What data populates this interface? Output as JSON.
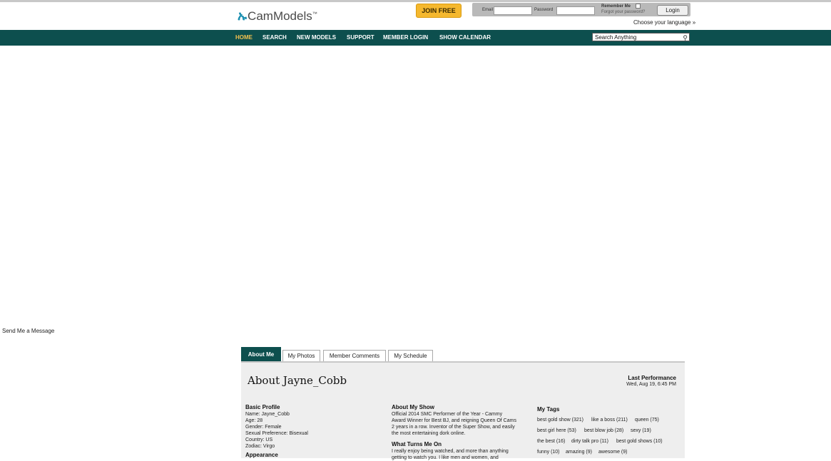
{
  "header": {
    "logo_text": "CamModels",
    "logo_tm": "™",
    "join_label": "JOIN FREE",
    "login": {
      "email_label": "Email",
      "password_label": "Password",
      "remember_label": "Remember Me",
      "forgot_label": "Forgot your password?",
      "login_button": "Login"
    },
    "choose_language": "Choose your language »"
  },
  "nav": {
    "items": [
      {
        "label": "HOME",
        "active": true
      },
      {
        "label": "SEARCH"
      },
      {
        "label": "NEW MODELS"
      },
      {
        "label": "SUPPORT"
      },
      {
        "label": "MEMBER LOGIN"
      },
      {
        "label": "SHOW CALENDAR"
      }
    ],
    "search_value": "Search Anything"
  },
  "send_message": "Send Me a Message",
  "tabs": [
    {
      "label": "About Me",
      "active": true
    },
    {
      "label": "My Photos"
    },
    {
      "label": "Member Comments"
    },
    {
      "label": "My Schedule"
    }
  ],
  "profile": {
    "title": "About Jayne_Cobb",
    "last_performance_label": "Last Performance",
    "last_performance_date": "Wed, Aug 19, 6:45 PM",
    "basic_heading": "Basic Profile",
    "basic_lines": [
      "Name: Jayne_Cobb",
      "Age: 28",
      "Gender: Female",
      "Sexual Preference: Bisexual",
      "Country: US",
      "Zodiac: Virgo"
    ],
    "appearance_heading": "Appearance",
    "show_heading": "About My Show",
    "show_lines": [
      "Official 2014 SMC Performer of the Year - Cammy",
      "Award Winner for Best BJ, and reigning Queen Of Cams",
      "2 years in a row. Inventor of the Super Show, and easily",
      "the most entertaining dork online."
    ],
    "turns_heading": "What Turns Me On",
    "turns_lines": [
      "I really enjoy being watched, and more than anything",
      "getting to watch you. I like men and women, and"
    ],
    "tags_heading": "My Tags",
    "tags": [
      "best gold show (321)",
      "like a boss (211)",
      "queen (75)",
      "best girl here (53)",
      "best blow job (28)",
      "sexy (19)",
      "the best (16)",
      "dirty talk pro (11)",
      "best gold shows (10)",
      "funny (10)",
      "amazing (9)",
      "awesome (9)"
    ]
  },
  "colors": {
    "nav_bg": "#0d4f4e",
    "join_bg": "#f5b82e",
    "active_nav": "#f2c14e",
    "panel_bg": "#eeeeee"
  }
}
